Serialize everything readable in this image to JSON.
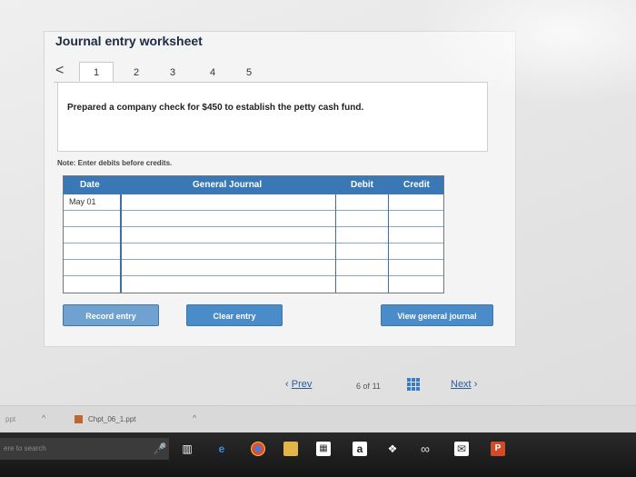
{
  "worksheet": {
    "title": "Journal entry worksheet",
    "prev_arrow": "<",
    "tabs": [
      "1",
      "2",
      "3",
      "4",
      "5"
    ],
    "active_tab": "1",
    "question": "Prepared a company check for $450 to establish the petty cash fund.",
    "note": "Note: Enter debits before credits."
  },
  "journal": {
    "headers": {
      "date": "Date",
      "general_journal": "General Journal",
      "debit": "Debit",
      "credit": "Credit"
    },
    "rows": [
      {
        "date": "May 01",
        "account": "",
        "debit": "",
        "credit": ""
      },
      {
        "date": "",
        "account": "",
        "debit": "",
        "credit": ""
      },
      {
        "date": "",
        "account": "",
        "debit": "",
        "credit": ""
      },
      {
        "date": "",
        "account": "",
        "debit": "",
        "credit": ""
      },
      {
        "date": "",
        "account": "",
        "debit": "",
        "credit": ""
      },
      {
        "date": "",
        "account": "",
        "debit": "",
        "credit": ""
      }
    ]
  },
  "buttons": {
    "record": "Record entry",
    "clear": "Clear entry",
    "view": "View general journal"
  },
  "pager": {
    "prev": "Prev",
    "current": "6",
    "of": "of",
    "total": "11",
    "next": "Next"
  },
  "download_bar": {
    "left_text": "ppt",
    "file": "Chpt_06_1.ppt"
  },
  "taskbar": {
    "search_placeholder": "ere to search",
    "icons": [
      "microphone-icon",
      "task-view-icon",
      "edge-icon",
      "chrome-icon",
      "file-explorer-icon",
      "store-icon",
      "amazon-icon",
      "dropbox-icon",
      "infinity-icon",
      "mail-icon",
      "powerpoint-icon"
    ]
  },
  "colors": {
    "table_header": "#3a78b5",
    "button": "#4a8bc9",
    "link": "#2a5d98"
  }
}
